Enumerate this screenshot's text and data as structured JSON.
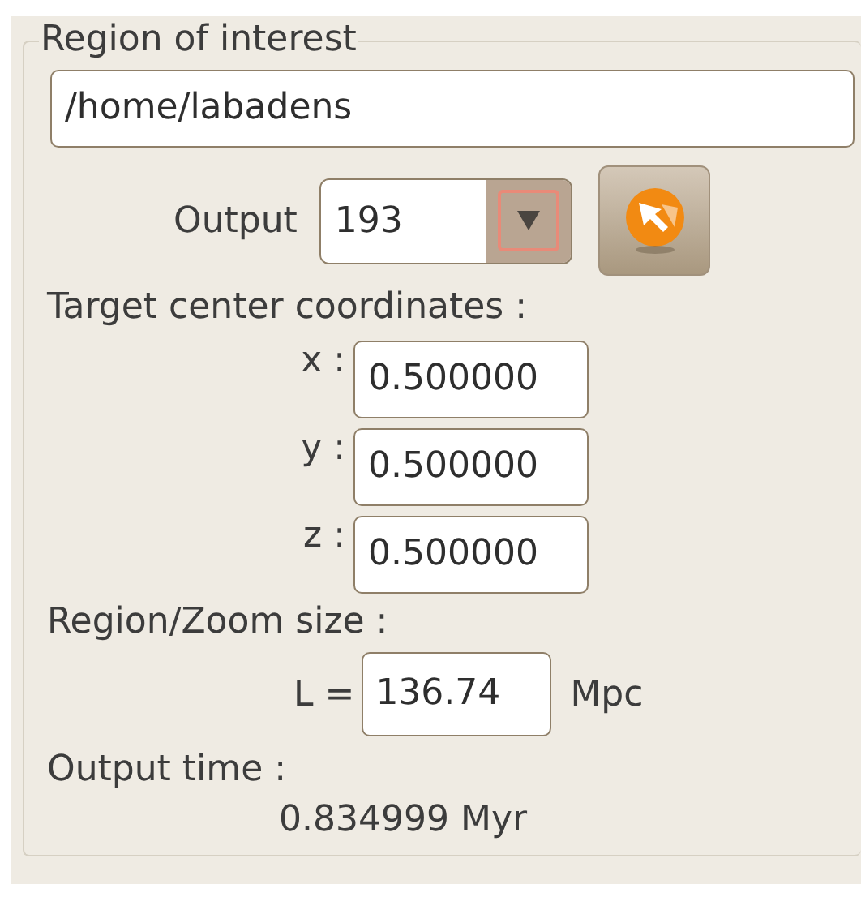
{
  "group": {
    "title": "Region of interest"
  },
  "path_field": {
    "value": "/home/labadens"
  },
  "output": {
    "label": "Output",
    "value": "193"
  },
  "coordinates": {
    "heading": "Target center coordinates :",
    "fields": [
      {
        "label": "x :",
        "value": "0.500000"
      },
      {
        "label": "y :",
        "value": "0.500000"
      },
      {
        "label": "z :",
        "value": "0.500000"
      }
    ]
  },
  "zoom": {
    "heading": "Region/Zoom size :",
    "label": "L =",
    "value": "136.74",
    "unit": "Mpc"
  },
  "output_time": {
    "heading": "Output time :",
    "value": "0.834999 Myr"
  }
}
